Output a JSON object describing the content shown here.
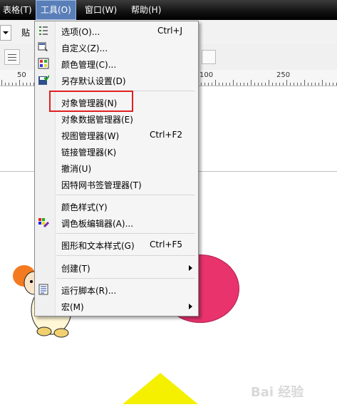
{
  "menubar": {
    "items": [
      {
        "label": "表格(T)"
      },
      {
        "label": "工具(O)"
      },
      {
        "label": "窗口(W)"
      },
      {
        "label": "帮助(H)"
      }
    ]
  },
  "toolbar": {
    "paste_label": "贴"
  },
  "ruler": {
    "ticks": [
      "50",
      "100",
      "250"
    ]
  },
  "tools_menu": {
    "items": [
      {
        "label": "选项(O)...",
        "shortcut": "Ctrl+J",
        "icon": "options-icon"
      },
      {
        "label": "自定义(Z)...",
        "shortcut": "",
        "icon": "customize-icon"
      },
      {
        "label": "颜色管理(C)...",
        "shortcut": "",
        "icon": "color-management-icon"
      },
      {
        "label": "另存默认设置(D)",
        "shortcut": "",
        "icon": "save-defaults-icon"
      },
      {
        "label": "对象管理器(N)",
        "shortcut": ""
      },
      {
        "label": "对象数据管理器(E)",
        "shortcut": ""
      },
      {
        "label": "视图管理器(W)",
        "shortcut": "Ctrl+F2"
      },
      {
        "label": "链接管理器(K)",
        "shortcut": ""
      },
      {
        "label": "撤消(U)",
        "shortcut": ""
      },
      {
        "label": "因特网书签管理器(T)",
        "shortcut": ""
      },
      {
        "label": "颜色样式(Y)",
        "shortcut": ""
      },
      {
        "label": "调色板编辑器(A)...",
        "shortcut": "",
        "icon": "palette-editor-icon"
      },
      {
        "label": "图形和文本样式(G)",
        "shortcut": "Ctrl+F5"
      },
      {
        "label": "创建(T)",
        "shortcut": ""
      },
      {
        "label": "运行脚本(R)...",
        "shortcut": "",
        "icon": "run-script-icon"
      },
      {
        "label": "宏(M)",
        "shortcut": ""
      }
    ]
  },
  "colors": {
    "highlight_box": "#e02020",
    "ellipse": "#e8336d",
    "triangle": "#f5f000",
    "menubar_active": "#5a7fb8"
  }
}
